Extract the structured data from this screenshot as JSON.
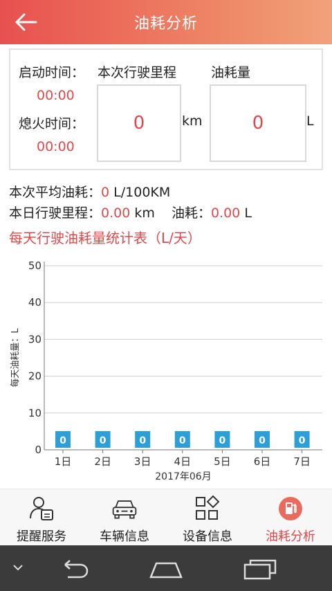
{
  "header": {
    "title": "油耗分析"
  },
  "summary": {
    "start_label": "启动时间：",
    "start_value": "00:00",
    "stop_label": "熄火时间：",
    "stop_value": "00:00",
    "mileage_label": "本次行驶里程",
    "mileage_value": "0",
    "mileage_unit": "km",
    "fuel_label": "油耗量",
    "fuel_value": "0",
    "fuel_unit": "L"
  },
  "stats": {
    "avg_label": "本次平均油耗：",
    "avg_value": "0",
    "avg_unit": "L/100KM",
    "day_mileage_label": "本日行驶里程：",
    "day_mileage_value": "0.00",
    "day_mileage_unit": "km",
    "day_fuel_label": "油耗：",
    "day_fuel_value": "0.00",
    "day_fuel_unit": "L"
  },
  "chart_title": "每天行驶油耗量统计表（L/天）",
  "chart_data": {
    "type": "bar",
    "categories": [
      "1日",
      "2日",
      "3日",
      "4日",
      "5日",
      "6日",
      "7日"
    ],
    "values": [
      0,
      0,
      0,
      0,
      0,
      0,
      0
    ],
    "data_labels": [
      "0",
      "0",
      "0",
      "0",
      "0",
      "0",
      "0"
    ],
    "xlabel": "2017年06月",
    "ylabel": "每天油耗量：L",
    "ylim": [
      0,
      50
    ],
    "yticks": [
      "0",
      "10",
      "20",
      "30",
      "40",
      "50"
    ],
    "grid": true,
    "bar_color": "#2d9fd8"
  },
  "nav": {
    "items": [
      {
        "label": "提醒服务",
        "icon": "reminder-person-icon",
        "active": false
      },
      {
        "label": "车辆信息",
        "icon": "car-icon",
        "active": false
      },
      {
        "label": "设备信息",
        "icon": "devices-grid-icon",
        "active": false
      },
      {
        "label": "油耗分析",
        "icon": "fuel-pump-icon",
        "active": true
      }
    ]
  },
  "colors": {
    "accent": "#e2484a",
    "header_start": "#e8504f",
    "header_end": "#f1a27a",
    "system_bar": "#3b3b3b"
  }
}
